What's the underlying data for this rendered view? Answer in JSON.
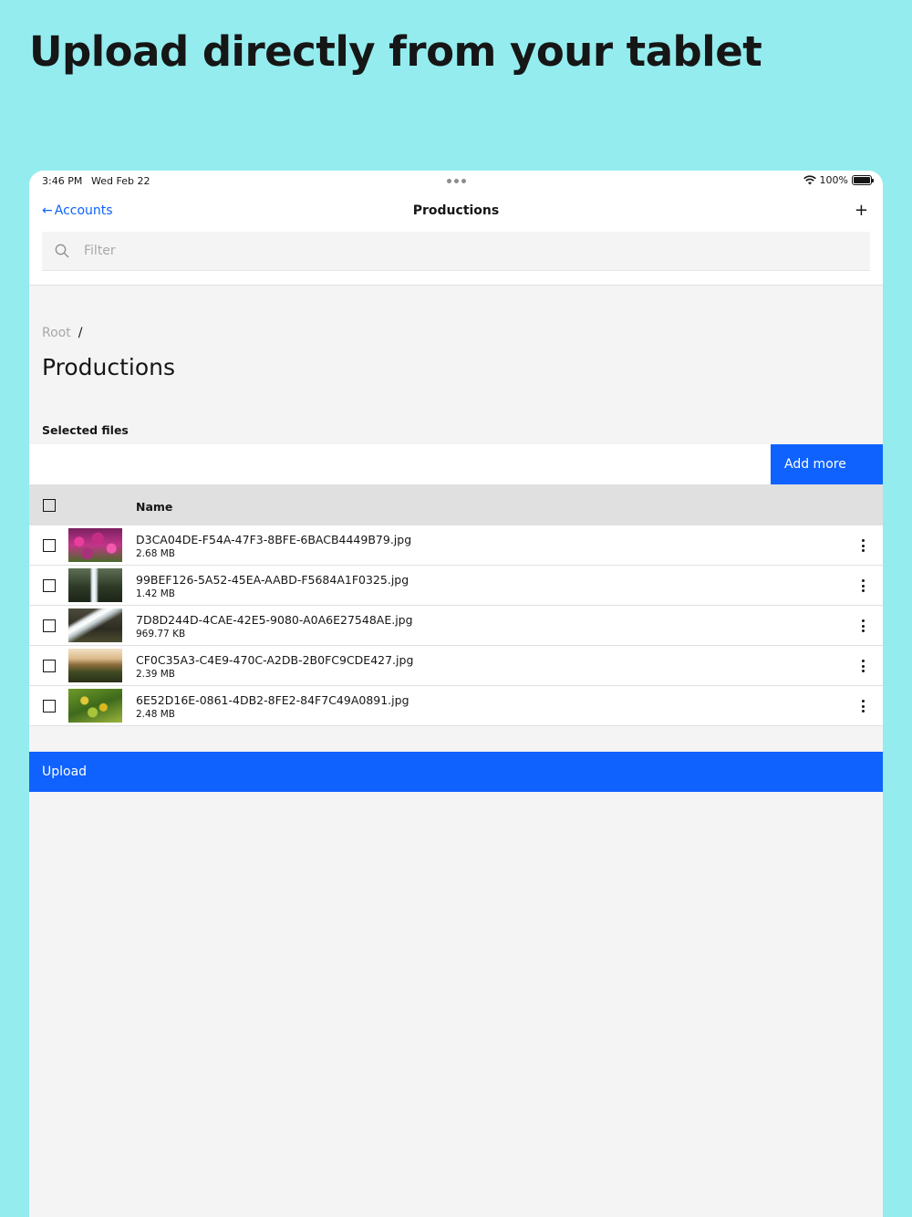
{
  "headline": "Upload directly from your tablet",
  "status_bar": {
    "time": "3:46 PM",
    "date": "Wed Feb 22",
    "battery": "100%"
  },
  "nav": {
    "back_label": "Accounts",
    "back_arrow": "←",
    "title": "Productions",
    "add_label": "+"
  },
  "filter": {
    "placeholder": "Filter"
  },
  "breadcrumb": {
    "root": "Root",
    "separator": "/"
  },
  "page_title": "Productions",
  "section_label": "Selected files",
  "add_more_label": "Add more",
  "table": {
    "header_name": "Name",
    "rows": [
      {
        "name": "D3CA04DE-F54A-47F3-8BFE-6BACB4449B79.jpg",
        "size": "2.68 MB"
      },
      {
        "name": "99BEF126-5A52-45EA-AABD-F5684A1F0325.jpg",
        "size": "1.42 MB"
      },
      {
        "name": "7D8D244D-4CAE-42E5-9080-A0A6E27548AE.jpg",
        "size": "969.77 KB"
      },
      {
        "name": "CF0C35A3-C4E9-470C-A2DB-2B0FC9CDE427.jpg",
        "size": "2.39 MB"
      },
      {
        "name": "6E52D16E-0861-4DB2-8FE2-84F7C49A0891.jpg",
        "size": "2.48 MB"
      }
    ]
  },
  "upload_label": "Upload",
  "colors": {
    "background": "#94ecee",
    "accent": "#0f62fe"
  }
}
